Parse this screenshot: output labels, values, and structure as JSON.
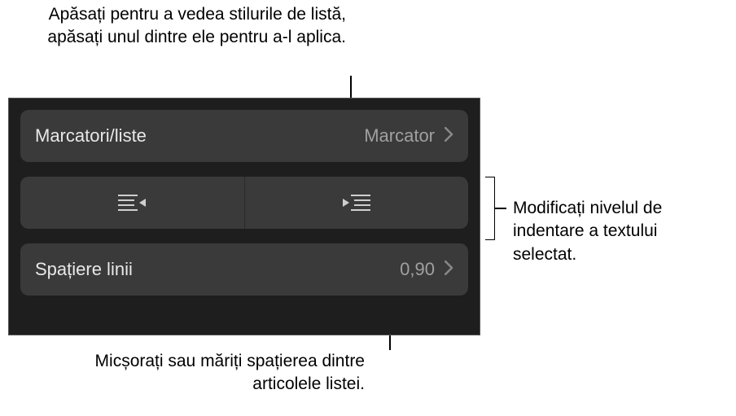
{
  "callouts": {
    "top": "Apăsați pentru a vedea stilurile de listă, apăsați unul dintre ele pentru a-l aplica.",
    "right": "Modificați nivelul de indentare a textului selectat.",
    "bottom": "Micșorați sau măriți spațierea dintre articolele listei."
  },
  "panel": {
    "bullets_lists": {
      "label": "Marcatori/liste",
      "value": "Marcator"
    },
    "line_spacing": {
      "label": "Spațiere linii",
      "value": "0,90"
    }
  }
}
